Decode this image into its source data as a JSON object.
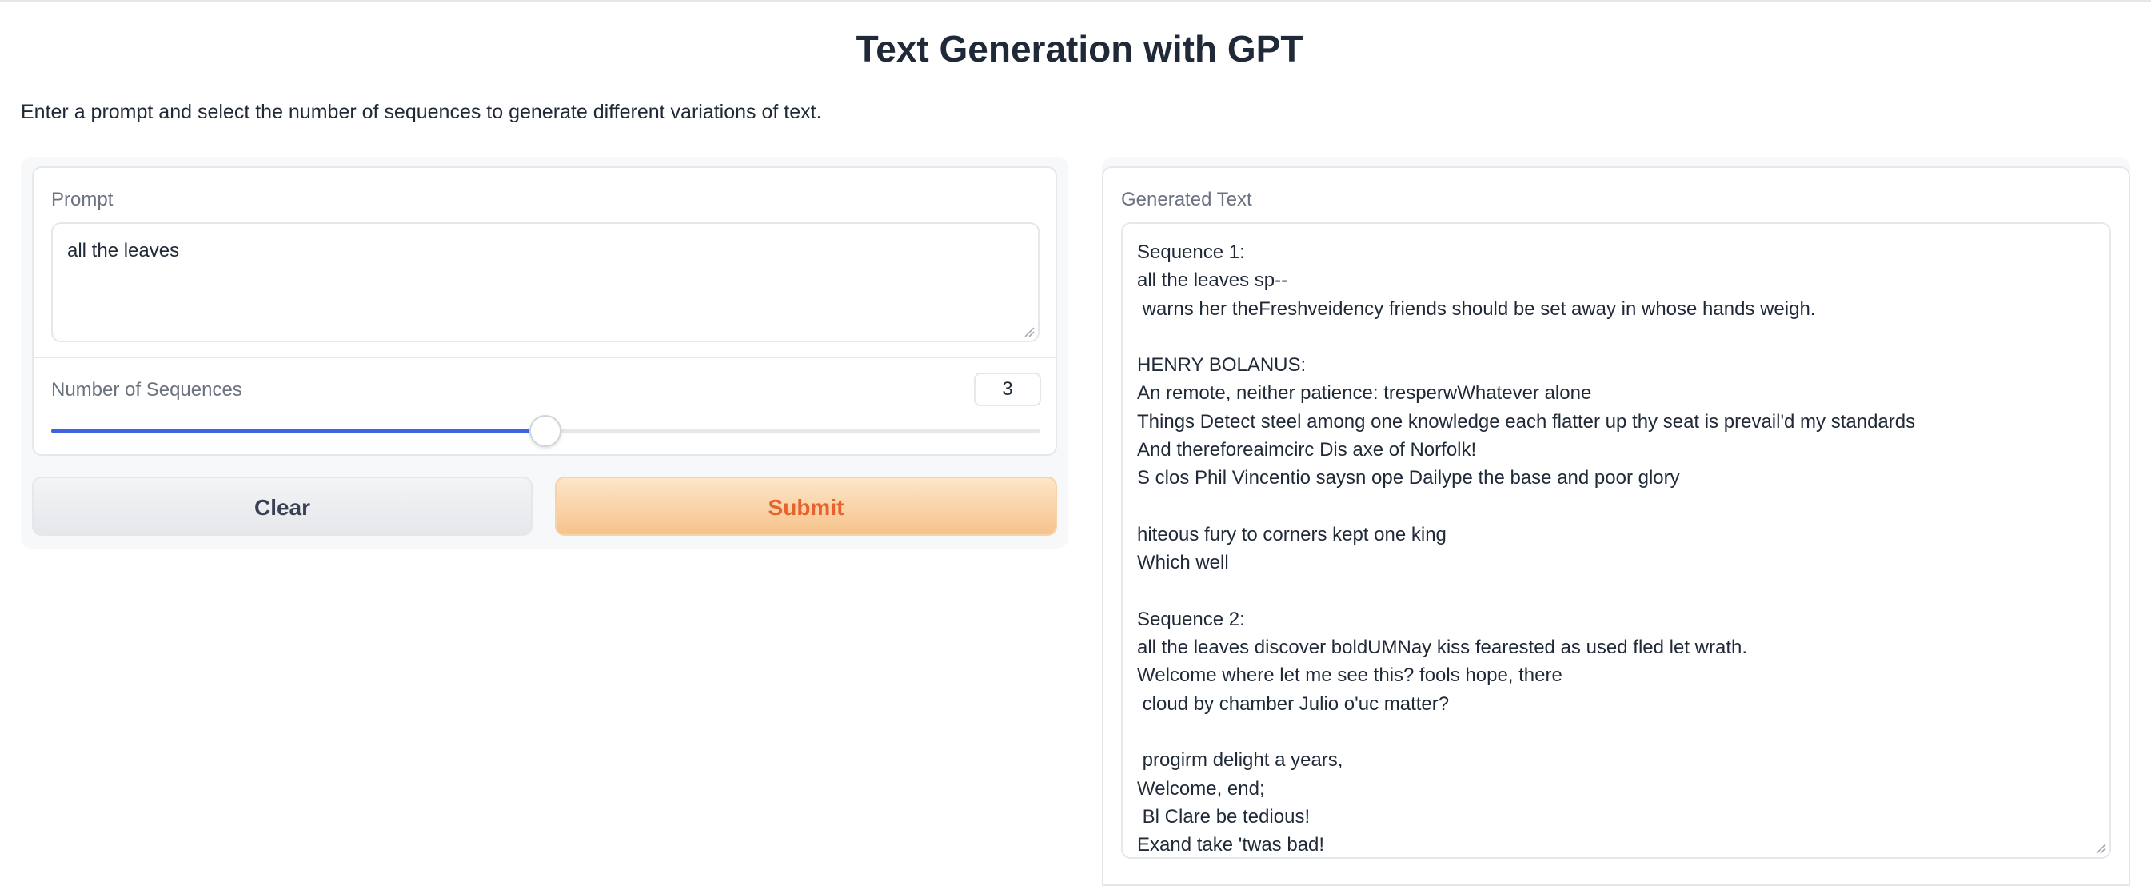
{
  "header": {
    "title": "Text Generation with GPT",
    "description": "Enter a prompt and select the number of sequences to generate different variations of text."
  },
  "inputs": {
    "prompt_label": "Prompt",
    "prompt_value": "all the leaves",
    "sequences_label": "Number of Sequences",
    "sequences_value": "3",
    "slider_fraction": 0.5
  },
  "buttons": {
    "clear_label": "Clear",
    "submit_label": "Submit"
  },
  "output": {
    "label": "Generated Text",
    "text": "Sequence 1:\nall the leaves sp--\n warns her theFreshveidency friends should be set away in whose hands weigh.\n\nHENRY BOLANUS:\nAn remote, neither patience: tresperwWhatever alone\nThings Detect steel among one knowledge each flatter up thy seat is prevail'd my standards\nAnd thereforeaimcirc Dis axe of Norfolk!\nS clos Phil Vincentio saysn ope Dailype the base and poor glory\n\nhiteous fury to corners kept one king\nWhich well\n\nSequence 2:\nall the leaves discover boldUMNay kiss fearested as used fled let wrath.\nWelcome where let me see this? fools hope, there\n cloud by chamber Julio o'uc matter?\n\n progirm delight a years,\nWelcome, end;\n Bl Clare be tedious!\nExand take 'twas bad!"
  },
  "colors": {
    "accent": "#3b63e5",
    "submit_text": "#e8622d",
    "submit_bg": "#f6c38c"
  }
}
